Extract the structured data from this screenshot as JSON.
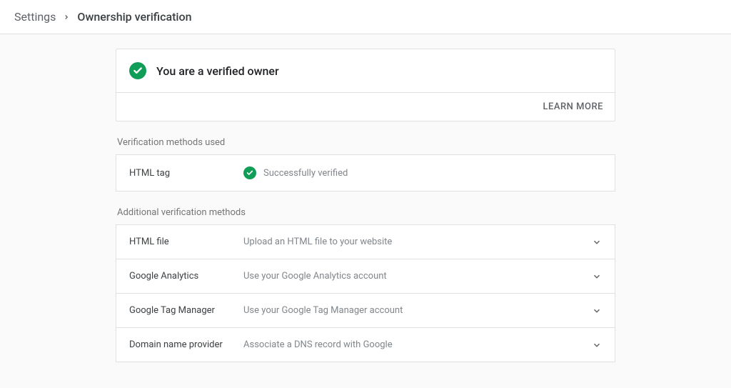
{
  "breadcrumb": {
    "parent": "Settings",
    "current": "Ownership verification"
  },
  "verified": {
    "title": "You are a verified owner",
    "learn_more": "LEARN MORE"
  },
  "sections": {
    "used_label": "Verification methods used",
    "additional_label": "Additional verification methods"
  },
  "used_methods": [
    {
      "name": "HTML tag",
      "status": "Successfully verified"
    }
  ],
  "additional_methods": [
    {
      "name": "HTML file",
      "desc": "Upload an HTML file to your website"
    },
    {
      "name": "Google Analytics",
      "desc": "Use your Google Analytics account"
    },
    {
      "name": "Google Tag Manager",
      "desc": "Use your Google Tag Manager account"
    },
    {
      "name": "Domain name provider",
      "desc": "Associate a DNS record with Google"
    }
  ],
  "colors": {
    "success": "#0f9d58",
    "muted": "#757575",
    "border": "#e0e0e0"
  }
}
